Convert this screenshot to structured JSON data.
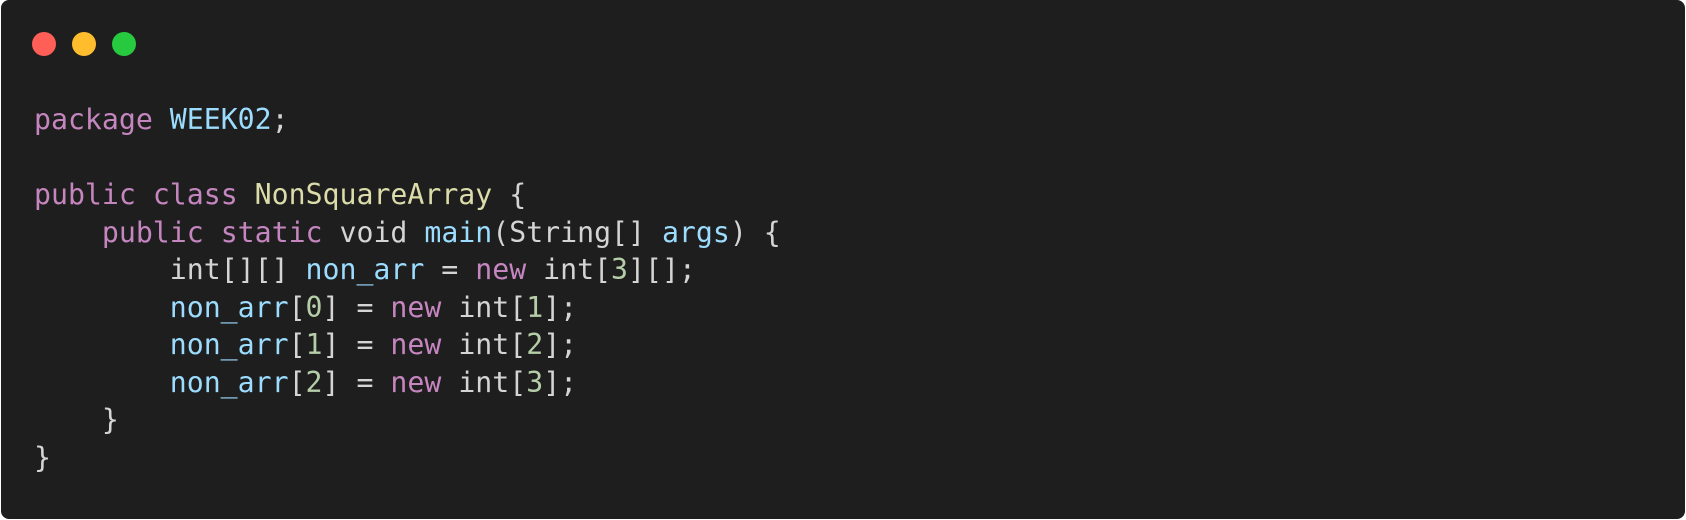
{
  "window": {
    "controls": [
      {
        "name": "close",
        "color": "#ff5f56"
      },
      {
        "name": "minimize",
        "color": "#ffbd2e"
      },
      {
        "name": "maximize",
        "color": "#27c93f"
      }
    ]
  },
  "colors": {
    "background": "#1e1e1e",
    "keyword": "#c586c0",
    "identifier": "#9cdcfe",
    "class_name": "#dcdcaa",
    "number": "#b5cea8",
    "plain": "#d4d4d4"
  },
  "code": {
    "lines": [
      [
        {
          "t": "package",
          "c": "keyword"
        },
        {
          "t": " ",
          "c": "plain"
        },
        {
          "t": "WEEK02",
          "c": "identifier"
        },
        {
          "t": ";",
          "c": "plain"
        }
      ],
      [],
      [
        {
          "t": "public",
          "c": "keyword"
        },
        {
          "t": " ",
          "c": "plain"
        },
        {
          "t": "class",
          "c": "keyword"
        },
        {
          "t": " ",
          "c": "plain"
        },
        {
          "t": "NonSquareArray",
          "c": "class_name"
        },
        {
          "t": " {",
          "c": "plain"
        }
      ],
      [
        {
          "t": "    ",
          "c": "plain"
        },
        {
          "t": "public",
          "c": "keyword"
        },
        {
          "t": " ",
          "c": "plain"
        },
        {
          "t": "static",
          "c": "keyword"
        },
        {
          "t": " void ",
          "c": "plain"
        },
        {
          "t": "main",
          "c": "identifier"
        },
        {
          "t": "(String[] ",
          "c": "plain"
        },
        {
          "t": "args",
          "c": "identifier"
        },
        {
          "t": ") {",
          "c": "plain"
        }
      ],
      [
        {
          "t": "        int[][] ",
          "c": "plain"
        },
        {
          "t": "non_arr",
          "c": "identifier"
        },
        {
          "t": " = ",
          "c": "plain"
        },
        {
          "t": "new",
          "c": "keyword"
        },
        {
          "t": " int[",
          "c": "plain"
        },
        {
          "t": "3",
          "c": "number"
        },
        {
          "t": "][];",
          "c": "plain"
        }
      ],
      [
        {
          "t": "        ",
          "c": "plain"
        },
        {
          "t": "non_arr",
          "c": "identifier"
        },
        {
          "t": "[",
          "c": "plain"
        },
        {
          "t": "0",
          "c": "number"
        },
        {
          "t": "] = ",
          "c": "plain"
        },
        {
          "t": "new",
          "c": "keyword"
        },
        {
          "t": " int[",
          "c": "plain"
        },
        {
          "t": "1",
          "c": "number"
        },
        {
          "t": "];",
          "c": "plain"
        }
      ],
      [
        {
          "t": "        ",
          "c": "plain"
        },
        {
          "t": "non_arr",
          "c": "identifier"
        },
        {
          "t": "[",
          "c": "plain"
        },
        {
          "t": "1",
          "c": "number"
        },
        {
          "t": "] = ",
          "c": "plain"
        },
        {
          "t": "new",
          "c": "keyword"
        },
        {
          "t": " int[",
          "c": "plain"
        },
        {
          "t": "2",
          "c": "number"
        },
        {
          "t": "];",
          "c": "plain"
        }
      ],
      [
        {
          "t": "        ",
          "c": "plain"
        },
        {
          "t": "non_arr",
          "c": "identifier"
        },
        {
          "t": "[",
          "c": "plain"
        },
        {
          "t": "2",
          "c": "number"
        },
        {
          "t": "] = ",
          "c": "plain"
        },
        {
          "t": "new",
          "c": "keyword"
        },
        {
          "t": " int[",
          "c": "plain"
        },
        {
          "t": "3",
          "c": "number"
        },
        {
          "t": "];",
          "c": "plain"
        }
      ],
      [
        {
          "t": "    }",
          "c": "plain"
        }
      ],
      [
        {
          "t": "}",
          "c": "plain"
        }
      ]
    ]
  }
}
